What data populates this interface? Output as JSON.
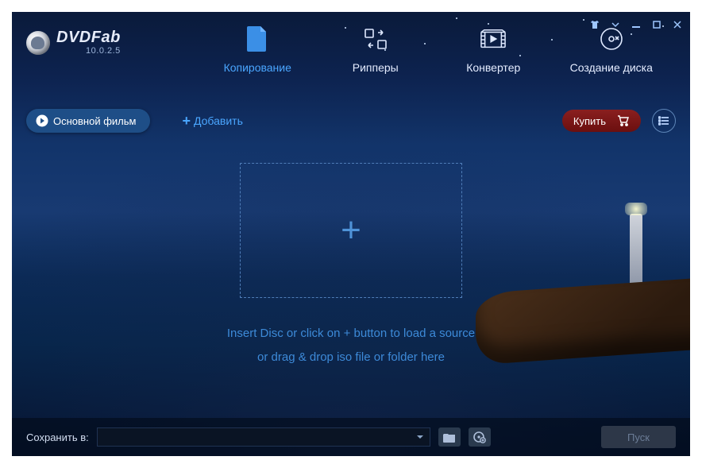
{
  "app": {
    "name": "DVDFab",
    "version": "10.0.2.5"
  },
  "tabs": {
    "copy": "Копирование",
    "ripper": "Рипперы",
    "convert": "Конвертер",
    "creator": "Создание диска"
  },
  "toolbar": {
    "main_movie": "Основной фильм",
    "add": "Добавить",
    "buy": "Купить"
  },
  "dropzone": {
    "line1": "Insert Disc or click on + button to load a source",
    "line2": "or drag & drop iso file or folder here"
  },
  "bottom": {
    "save_to": "Сохранить в:",
    "save_path": "",
    "start": "Пуск"
  }
}
